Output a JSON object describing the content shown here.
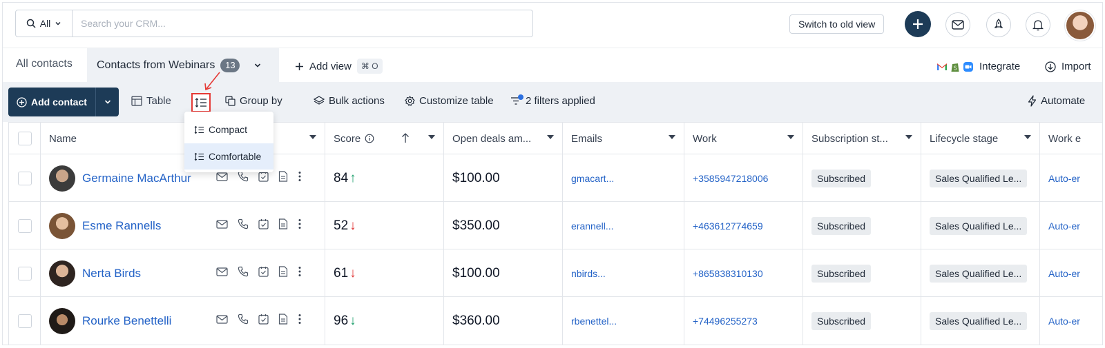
{
  "search": {
    "scope_label": "All",
    "placeholder": "Search your CRM..."
  },
  "header": {
    "switch_label": "Switch to old view"
  },
  "tabs": {
    "all_label": "All contacts",
    "active_label": "Contacts from Webinars",
    "active_count": "13",
    "add_view_label": "Add view",
    "add_view_shortcut": "⌘ O",
    "integrate_label": "Integrate",
    "import_label": "Import"
  },
  "toolbar": {
    "add_contact_label": "Add contact",
    "table_label": "Table",
    "group_by_label": "Group by",
    "bulk_actions_label": "Bulk actions",
    "customize_label": "Customize table",
    "filters_label": "2 filters applied",
    "automate_label": "Automate"
  },
  "density_menu": {
    "items": [
      {
        "label": "Compact"
      },
      {
        "label": "Comfortable",
        "selected": true
      }
    ]
  },
  "columns": {
    "name": "Name",
    "score": "Score",
    "open_deals": "Open deals am...",
    "emails": "Emails",
    "work": "Work",
    "subscription": "Subscription st...",
    "lifecycle": "Lifecycle stage",
    "work_email": "Work e"
  },
  "rows": [
    {
      "name": "Germaine MacArthur",
      "score": "84",
      "trend": "↑",
      "deal": "$100.00",
      "email": "gmacart...",
      "work": "+3585947218006",
      "subscription": "Subscribed",
      "lifecycle": "Sales Qualified Le...",
      "work_email": "Auto-er"
    },
    {
      "name": "Esme Rannells",
      "score": "52",
      "trend": "↓",
      "deal": "$350.00",
      "email": "erannell...",
      "work": "+463612774659",
      "subscription": "Subscribed",
      "lifecycle": "Sales Qualified Le...",
      "work_email": "Auto-er"
    },
    {
      "name": "Nerta Birds",
      "score": "61",
      "trend": "↓",
      "deal": "$100.00",
      "email": "nbirds...",
      "work": "+865838310130",
      "subscription": "Subscribed",
      "lifecycle": "Sales Qualified Le...",
      "work_email": "Auto-er"
    },
    {
      "name": "Rourke Benettelli",
      "score": "96",
      "trend": "↓",
      "deal": "$360.00",
      "email": "rbenettel...",
      "work": "+74496255273",
      "subscription": "Subscribed",
      "lifecycle": "Sales Qualified Le...",
      "work_email": "Auto-er"
    }
  ],
  "colors": {
    "primary": "#1d3b57",
    "link": "#2463c7",
    "up": "#1a9e6a",
    "down": "#e03131",
    "highlight": "#e53935"
  }
}
